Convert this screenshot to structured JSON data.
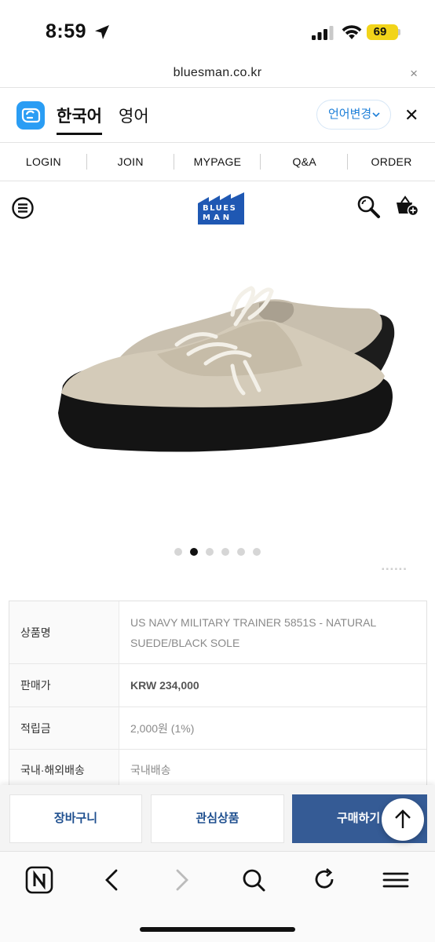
{
  "status_bar": {
    "time": "8:59",
    "battery": "69",
    "icons": [
      "location-arrow-icon",
      "signal-icon",
      "wifi-icon",
      "battery-icon"
    ]
  },
  "browser": {
    "url": "bluesman.co.kr",
    "close_glyph": "×"
  },
  "translate_bar": {
    "app_icon": "translate-app-icon",
    "source_lang": "한국어",
    "target_lang": "영어",
    "change_label": "언어변경",
    "close_glyph": "✕"
  },
  "top_nav": {
    "items": [
      "LOGIN",
      "JOIN",
      "MYPAGE",
      "Q&A",
      "ORDER"
    ]
  },
  "header": {
    "logo_text_line1": "BLUES",
    "logo_text_line2": "MAN",
    "icons": [
      "menu-icon",
      "search-icon",
      "cart-icon"
    ]
  },
  "gallery": {
    "slide_count": 6,
    "active_index": 1
  },
  "product": {
    "rows": [
      {
        "label": "상품명",
        "value": "US NAVY MILITARY TRAINER 5851S - NATURAL SUEDE/BLACK SOLE"
      },
      {
        "label": "판매가",
        "value": "KRW 234,000"
      },
      {
        "label": "적립금",
        "value": "2,000원 (1%)"
      },
      {
        "label": "국내·해외배송",
        "value": "국내배송"
      }
    ]
  },
  "actions": {
    "cart": "장바구니",
    "wishlist": "관심상품",
    "buy": "구매하기"
  },
  "colors": {
    "accent": "#355b95",
    "link_blue": "#1d7fd8",
    "battery": "#f2d41a"
  }
}
